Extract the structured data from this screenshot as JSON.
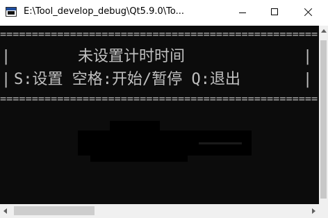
{
  "window": {
    "title": "E:\\Tool_develop_debug\\Qt5.9.0\\To...",
    "app_icon": "console-app-icon",
    "controls": {
      "minimize_icon": "minimize-icon",
      "maximize_icon": "maximize-icon",
      "close_icon": "close-icon"
    }
  },
  "console": {
    "rule_top": "==================================================",
    "line_status": "未设置计时时间",
    "line_help": "S:设置 空格:开始/暂停 Q:退出",
    "border_left": "|",
    "border_right": "|",
    "rule_bottom": "==================================================",
    "colors": {
      "background": "#0c0c0c",
      "foreground": "#c0c0c0"
    }
  },
  "scrollbars": {
    "vertical": "vertical-scrollbar",
    "horizontal": "horizontal-scrollbar"
  }
}
